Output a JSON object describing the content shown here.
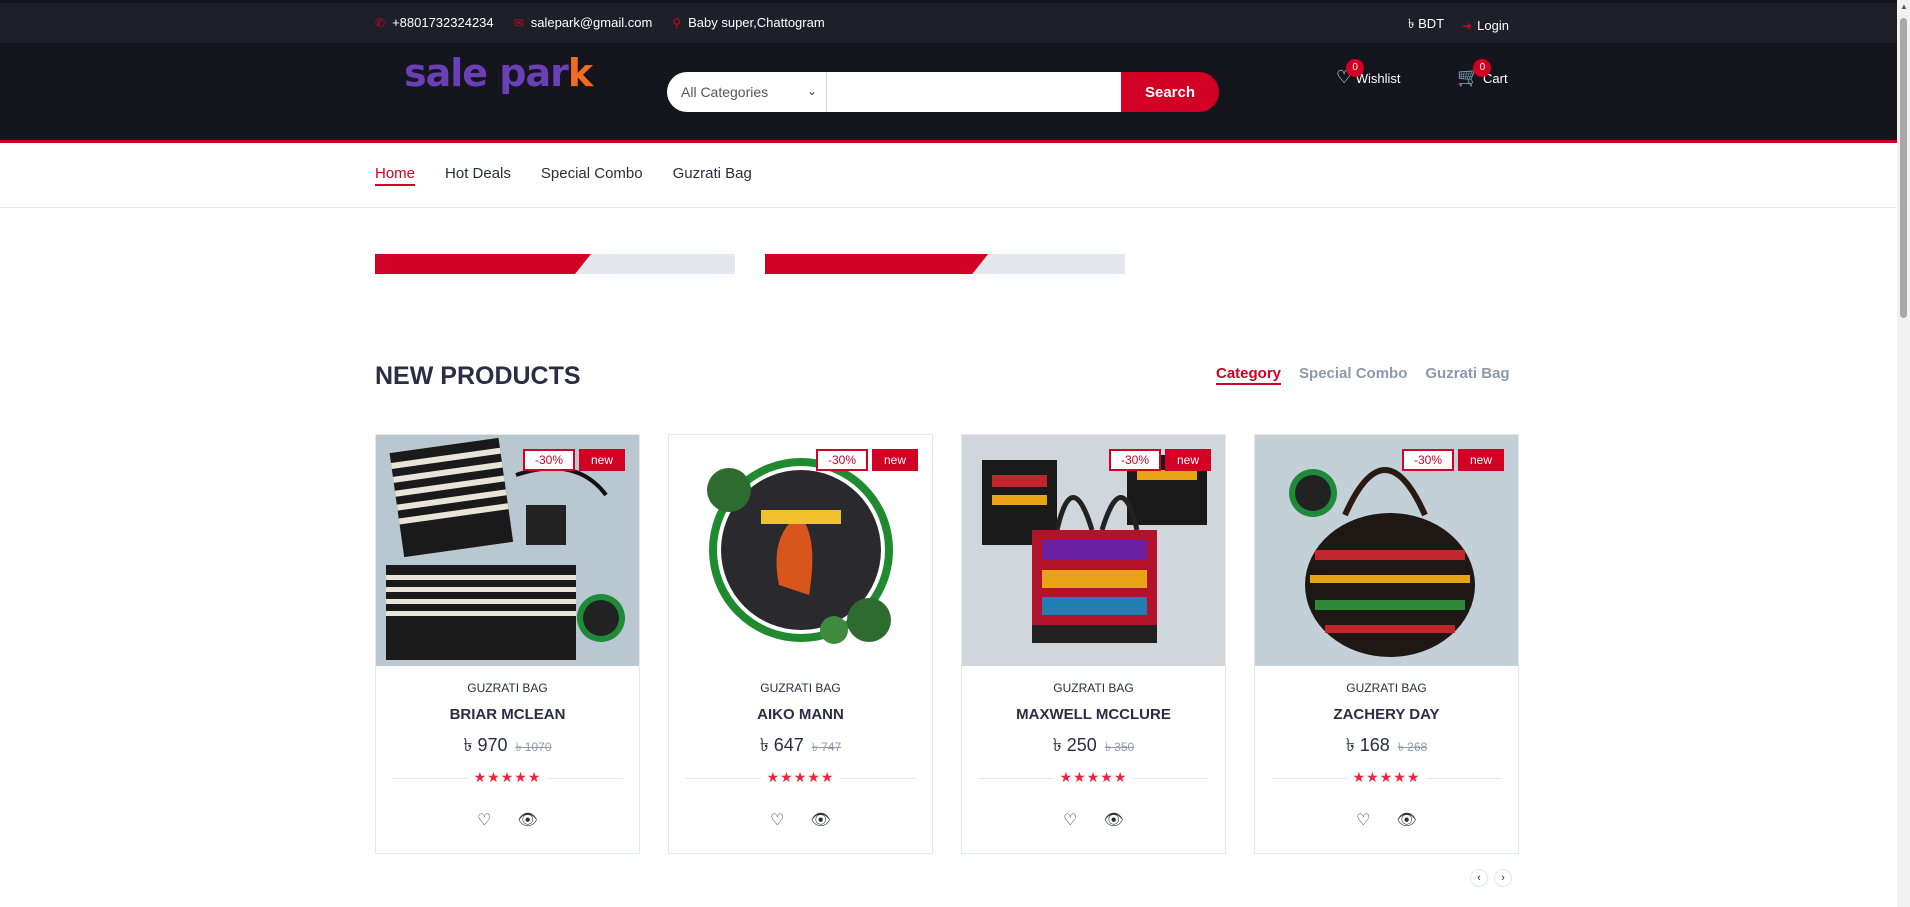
{
  "topbar": {
    "phone": "+8801732324234",
    "email": "salepark@gmail.com",
    "location": "Baby super,Chattogram",
    "currency": "৳ BDT",
    "login": "Login"
  },
  "header": {
    "logo_part1": "sale par",
    "logo_part2": "k",
    "category_select": "All Categories",
    "search_placeholder": "",
    "search_button": "Search",
    "wishlist_label": "Wishlist",
    "wishlist_count": "0",
    "cart_label": "Cart",
    "cart_count": "0"
  },
  "nav": {
    "items": [
      {
        "label": "Home"
      },
      {
        "label": "Hot Deals"
      },
      {
        "label": "Special Combo"
      },
      {
        "label": "Guzrati Bag"
      }
    ]
  },
  "progress": [
    {
      "percent": 60
    },
    {
      "percent": 62
    }
  ],
  "section": {
    "title": "NEW PRODUCTS",
    "tabs": [
      {
        "label": "Category"
      },
      {
        "label": "Special Combo"
      },
      {
        "label": "Guzrati Bag"
      }
    ]
  },
  "products": [
    {
      "sale": "-30%",
      "tag": "new",
      "category": "GUZRATI BAG",
      "name": "BRIAR MCLEAN",
      "price": "৳ 970",
      "old_price": "৳ 1070",
      "stars": "★★★★★"
    },
    {
      "sale": "-30%",
      "tag": "new",
      "category": "GUZRATI BAG",
      "name": "AIKO MANN",
      "price": "৳ 647",
      "old_price": "৳ 747",
      "stars": "★★★★★"
    },
    {
      "sale": "-30%",
      "tag": "new",
      "category": "GUZRATI BAG",
      "name": "MAXWELL MCCLURE",
      "price": "৳ 250",
      "old_price": "৳ 350",
      "stars": "★★★★★"
    },
    {
      "sale": "-30%",
      "tag": "new",
      "category": "GUZRATI BAG",
      "name": "ZACHERY DAY",
      "price": "৳ 168",
      "old_price": "৳ 268",
      "stars": "★★★★★"
    }
  ],
  "icons": {
    "phone": "phone-icon",
    "email": "envelope-icon",
    "location": "map-marker-icon",
    "login": "sign-in-icon",
    "wishlist": "heart-icon",
    "cart": "shopping-cart-icon",
    "quick_view": "eye-icon"
  },
  "colors": {
    "accent": "#d10024",
    "dark": "#15161d",
    "topbar": "#1e1f29"
  }
}
